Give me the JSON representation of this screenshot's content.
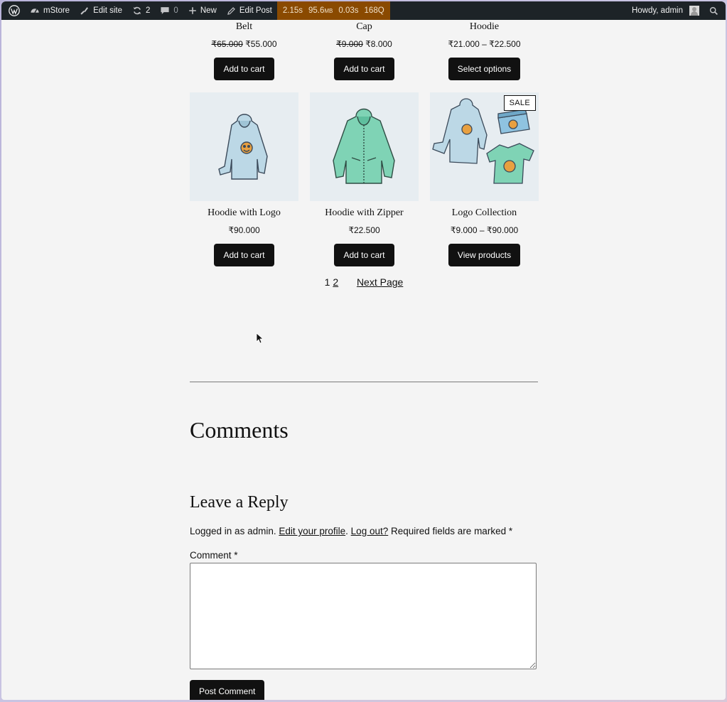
{
  "admin_bar": {
    "site_name": "mStore",
    "edit_site": "Edit site",
    "updates_count": "2",
    "comments_count": "0",
    "new_label": "New",
    "edit_post": "Edit Post",
    "perf": {
      "time": "2.15s",
      "memory": "95.6",
      "memory_unit": "MB",
      "query_time": "0.03s",
      "queries": "168Q"
    },
    "greeting": "Howdy, admin"
  },
  "products_row1": [
    {
      "title": "Belt",
      "price_old": "₹65.000",
      "price_new": "₹55.000",
      "button": "Add to cart"
    },
    {
      "title": "Cap",
      "price_old": "₹9.000",
      "price_new": "₹8.000",
      "button": "Add to cart"
    },
    {
      "title": "Hoodie",
      "price_range": "₹21.000 – ₹22.500",
      "button": "Select options"
    }
  ],
  "products_row2": [
    {
      "title": "Hoodie with Logo",
      "price": "₹90.000",
      "button": "Add to cart"
    },
    {
      "title": "Hoodie with Zipper",
      "price": "₹22.500",
      "button": "Add to cart"
    },
    {
      "title": "Logo Collection",
      "price": "₹9.000 – ₹90.000",
      "button": "View products",
      "badge": "SALE"
    }
  ],
  "pagination": {
    "current": "1",
    "page2": "2",
    "next": "Next Page"
  },
  "comments": {
    "title": "Comments",
    "reply_title": "Leave a Reply",
    "logged_prefix": "Logged in as admin.",
    "edit_profile": "Edit your profile",
    "log_out": "Log out?",
    "required_note": "Required fields are marked *",
    "comment_label": "Comment *",
    "submit": "Post Comment"
  },
  "colors": {
    "admin_bar_bg": "#1d2327",
    "perf_bg": "#8a4a00",
    "button_bg": "#111111",
    "page_bg": "#f4f4f4"
  }
}
